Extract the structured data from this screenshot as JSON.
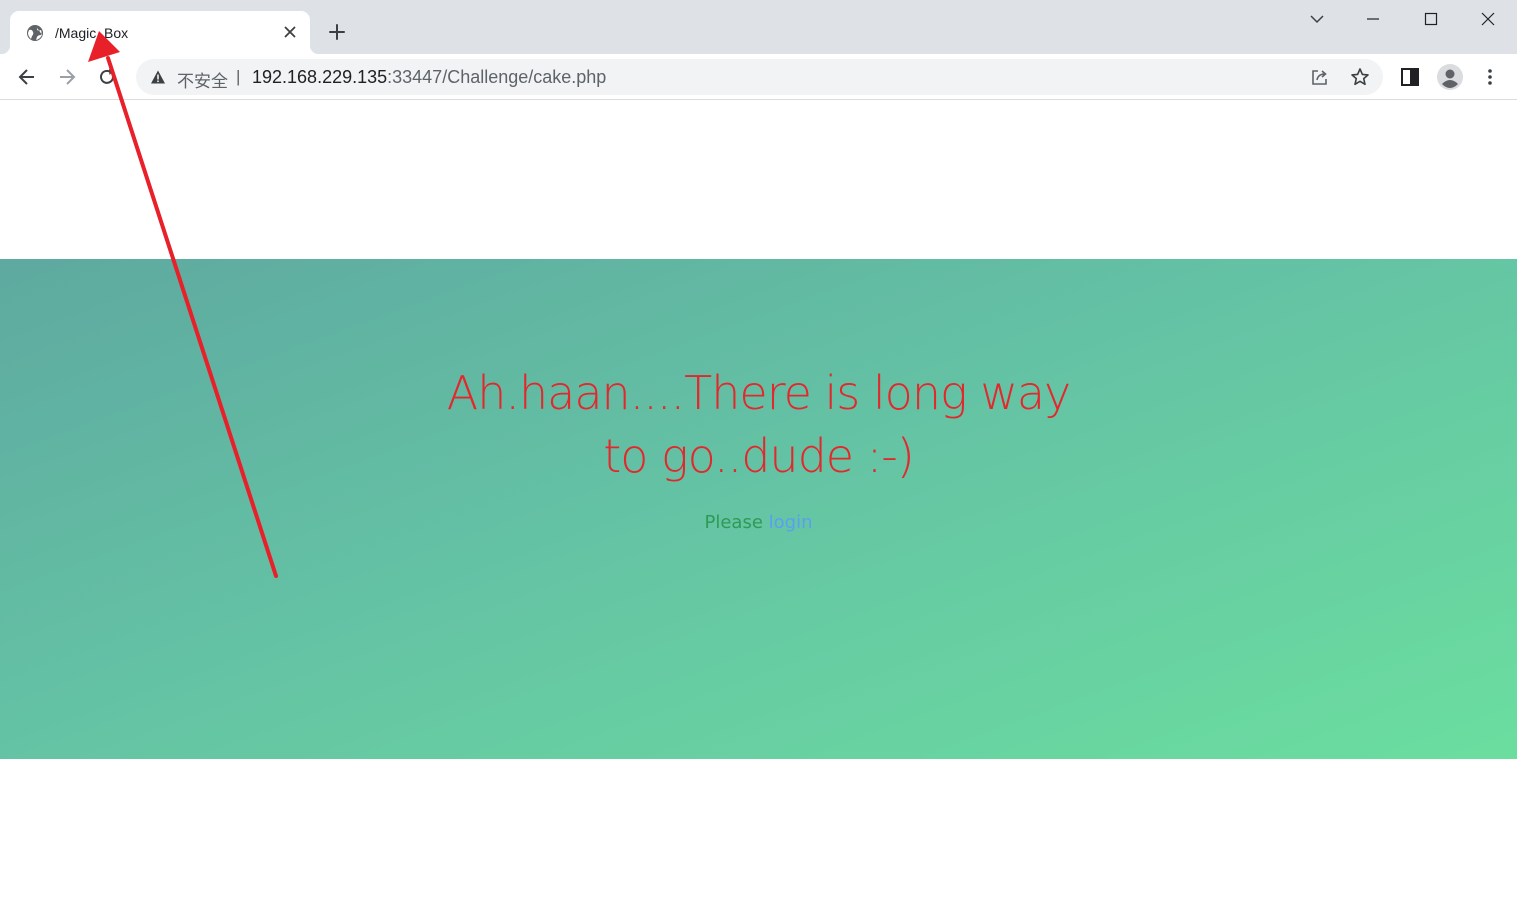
{
  "browser": {
    "tab": {
      "title": "/Magic_Box",
      "favicon": "globe-icon"
    },
    "new_tab_icon": "plus-icon",
    "window_controls": [
      "chevron-down-icon",
      "minimize-icon",
      "maximize-icon",
      "close-icon"
    ],
    "nav": {
      "back": "arrow-left-icon",
      "forward": "arrow-right-icon",
      "reload": "reload-icon"
    },
    "omnibox": {
      "security_label": "不安全",
      "separator": "|",
      "url_host": "192.168.229.135",
      "url_rest": ":33447/Challenge/cake.php"
    },
    "toolbar_icons": [
      "share-icon",
      "star-icon",
      "side-panel-icon",
      "profile-icon",
      "kebab-menu-icon"
    ]
  },
  "page": {
    "headline": "Ah.haan....There is long way to go..dude :-)",
    "prompt_text": "Please ",
    "prompt_link": "login",
    "colors": {
      "headline": "#e2282c",
      "prompt_text": "#2f9a55",
      "link": "#5c9ff0",
      "banner_start": "#5ea9a0",
      "banner_end": "#6bde9f"
    }
  },
  "annotation": {
    "type": "arrow",
    "color": "#e8202a"
  }
}
